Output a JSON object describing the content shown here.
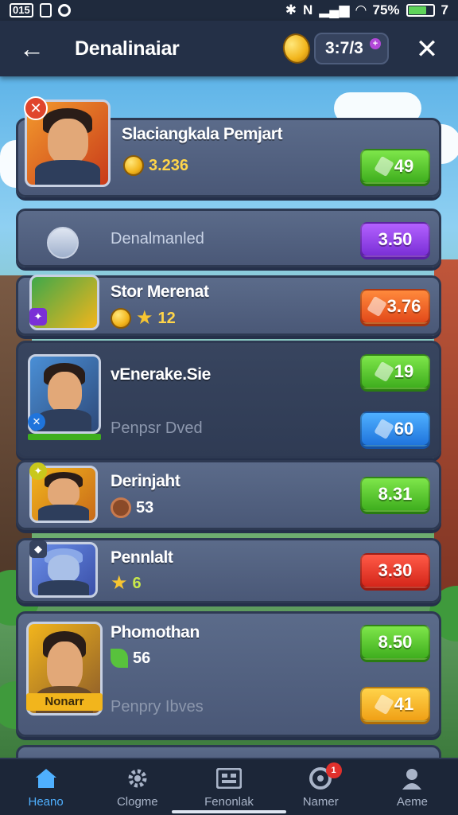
{
  "status_bar": {
    "left_box": "015",
    "battery_percent": "75%",
    "right_number": "7"
  },
  "header": {
    "title": "Denalinaiar",
    "currency_value": "3:7/3"
  },
  "rows": [
    {
      "name": "Slaciangkala Pemjart",
      "stat_value": "3.236",
      "stat_icon": "coin-icon",
      "button_label": "49",
      "button_color": "green"
    },
    {
      "name": "Denalmanled",
      "button_label": "3.50",
      "button_color": "purple"
    },
    {
      "name": "Stor Merenat",
      "banner_text": "",
      "stat_value": "12",
      "stat_icon": "star-icon",
      "button_label": "3.76",
      "button_color": "orange"
    },
    {
      "name": "vEnerake.Sie",
      "sub_text": "Penpsr Dved",
      "button_label": "19",
      "button_color": "green",
      "button2_label": "60",
      "button2_color": "blue"
    },
    {
      "name": "Derinjaht",
      "stat_value": "53",
      "stat_icon": "chip-icon",
      "button_label": "8.31",
      "button_color": "green"
    },
    {
      "name": "Pennlalt",
      "stat_value": "6",
      "stat_icon": "star-icon",
      "button_label": "3.30",
      "button_color": "red"
    },
    {
      "name": "Phomothan",
      "stat_value": "56",
      "stat_icon": "leaf-icon",
      "sub_text": "Penpry Ibves",
      "banner_text": "Nonarr",
      "button_label": "8.50",
      "button_color": "green",
      "button2_label": "41",
      "button2_color": "yellow"
    }
  ],
  "bottom_nav": [
    {
      "label": "Heano",
      "icon": "home-icon",
      "active": true
    },
    {
      "label": "Clogme",
      "icon": "gear-icon",
      "active": false
    },
    {
      "label": "Fenonlak",
      "icon": "grid-icon",
      "active": false
    },
    {
      "label": "Namer",
      "icon": "target-icon",
      "active": false,
      "badge": "1"
    },
    {
      "label": "Aeme",
      "icon": "profile-icon",
      "active": false
    }
  ]
}
